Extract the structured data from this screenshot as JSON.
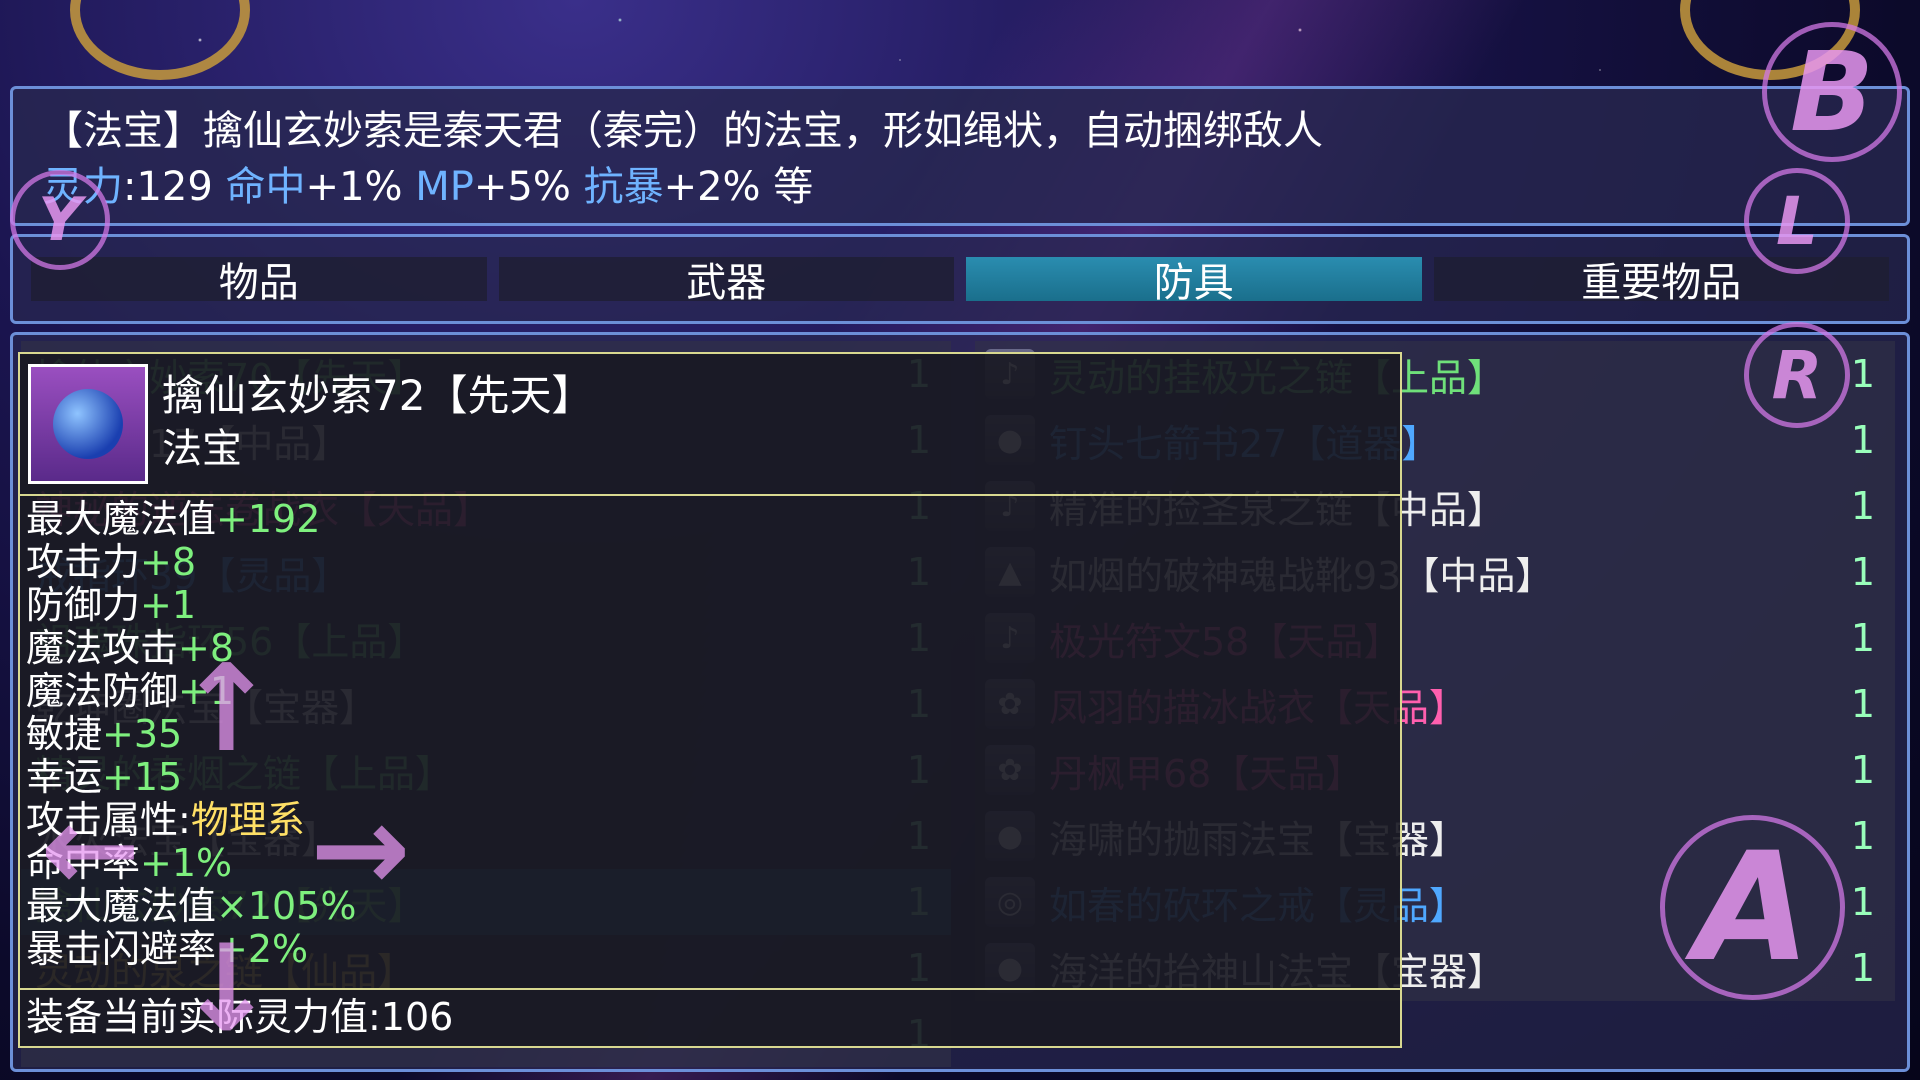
{
  "description": {
    "line1": "【法宝】擒仙玄妙索是秦天君（秦完）的法宝，形如绳状，自动捆绑敌人",
    "stats": [
      {
        "label": "灵力",
        "value": ":129"
      },
      {
        "label": "命中",
        "value": "+1%"
      },
      {
        "label": "MP",
        "value": "+5%"
      },
      {
        "label": "抗暴",
        "value": "+2%"
      },
      {
        "label": "",
        "value": "等"
      }
    ]
  },
  "tabs": [
    "物品",
    "武器",
    "防具",
    "重要物品"
  ],
  "active_tab": "防具",
  "left_list": [
    {
      "name": "擒仙玄妙索70【先天】",
      "count": "1",
      "color": "c-green"
    },
    {
      "name": "仙缘环17【中品】",
      "count": "1",
      "color": "c-white"
    },
    {
      "name": "神秘的逆法卷战衣【天品】",
      "count": "1",
      "color": "c-pink"
    },
    {
      "name": "戒指环39【灵品】",
      "count": "1",
      "color": "c-blue"
    },
    {
      "name": "祖魂珠指环56【上品】",
      "count": "1",
      "color": "c-green"
    },
    {
      "name": "乾坤圈法宝【宝器】",
      "count": "1",
      "color": "c-white"
    },
    {
      "name": "精灵的春烟之链【上品】",
      "count": "1",
      "color": "c-green"
    },
    {
      "name": "水火法宝【宝器】",
      "count": "1",
      "color": "c-white"
    },
    {
      "name": "擒仙玄妙索72【先天】",
      "count": "1",
      "color": "c-green"
    },
    {
      "name": "灵动的泉之链【仙品】",
      "count": "1",
      "color": "c-gold"
    },
    {
      "name": "",
      "count": "1",
      "color": "c-white"
    }
  ],
  "right_list": [
    {
      "name": "灵动的挂极光之链【上品】",
      "count": "1",
      "color": "c-green",
      "icon": "♪"
    },
    {
      "name": "钉头七箭书27【道器】",
      "count": "1",
      "color": "c-blue",
      "icon": "●"
    },
    {
      "name": "精准的捡圣泉之链【中品】",
      "count": "1",
      "color": "c-white",
      "icon": "♪"
    },
    {
      "name": "如烟的破神魂战靴93【中品】",
      "count": "1",
      "color": "c-white",
      "icon": "▲"
    },
    {
      "name": "极光符文58【天品】",
      "count": "1",
      "color": "c-pink",
      "icon": "♪"
    },
    {
      "name": "凤羽的描冰战衣【天品】",
      "count": "1",
      "color": "c-pink",
      "icon": "✿"
    },
    {
      "name": "丹枫甲68【天品】",
      "count": "1",
      "color": "c-pink",
      "icon": "✿"
    },
    {
      "name": "海啸的抛雨法宝【宝器】",
      "count": "1",
      "color": "c-white",
      "icon": "●"
    },
    {
      "name": "如春的砍环之戒【灵品】",
      "count": "1",
      "color": "c-blue",
      "icon": "◎"
    },
    {
      "name": "海洋的抬神山法宝【宝器】",
      "count": "1",
      "color": "c-white",
      "icon": "●"
    }
  ],
  "popup": {
    "title": "擒仙玄妙索72【先天】",
    "subtitle": "法宝",
    "stats": [
      {
        "k": "最大魔法值",
        "v": "+192",
        "style": "v"
      },
      {
        "k": "攻击力",
        "v": "+8",
        "style": "v"
      },
      {
        "k": "防御力",
        "v": "+1",
        "style": "v"
      },
      {
        "k": "魔法攻击",
        "v": "+8",
        "style": "v"
      },
      {
        "k": "魔法防御",
        "v": "+1",
        "style": "v"
      },
      {
        "k": "敏捷",
        "v": "+35",
        "style": "v"
      },
      {
        "k": "幸运",
        "v": "+15",
        "style": "v"
      },
      {
        "k": "攻击属性:",
        "v": "物理系",
        "style": "v2"
      },
      {
        "k": "命中率",
        "v": "+1%",
        "style": "v"
      },
      {
        "k": "最大魔法值",
        "v": "×105%",
        "style": "v"
      },
      {
        "k": "暴击闪避率",
        "v": "+2%",
        "style": "v"
      }
    ],
    "footer": "装备当前实际灵力值:106"
  },
  "virtual_buttons": {
    "b": "B",
    "y": "Y",
    "l": "L",
    "r": "R",
    "a": "A"
  },
  "dpad": {
    "up": "↑",
    "right": "→",
    "left": "←",
    "down": "↓"
  }
}
